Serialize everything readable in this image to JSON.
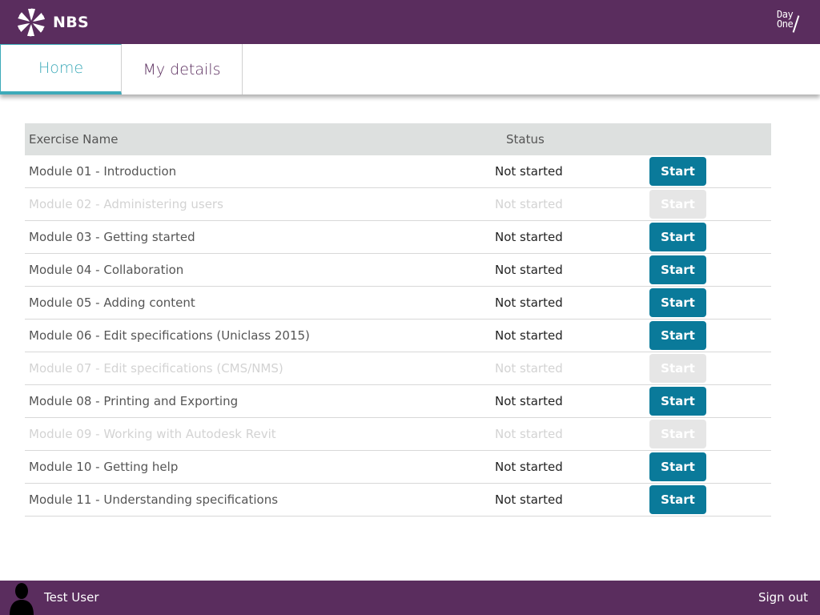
{
  "header": {
    "brand": "NBS",
    "partner_logo": [
      "Day",
      "One"
    ]
  },
  "tabs": [
    {
      "label": "Home",
      "active": true
    },
    {
      "label": "My details",
      "active": false
    }
  ],
  "table": {
    "columns": [
      "Exercise Name",
      "Status"
    ],
    "rows": [
      {
        "name": "Module 01 - Introduction",
        "status": "Not started",
        "button": "Start",
        "enabled": true
      },
      {
        "name": "Module 02 - Administering users",
        "status": "Not started",
        "button": "Start",
        "enabled": false
      },
      {
        "name": "Module 03 - Getting started",
        "status": "Not started",
        "button": "Start",
        "enabled": true
      },
      {
        "name": "Module 04 - Collaboration",
        "status": "Not started",
        "button": "Start",
        "enabled": true
      },
      {
        "name": "Module 05 - Adding content",
        "status": "Not started",
        "button": "Start",
        "enabled": true
      },
      {
        "name": "Module 06 - Edit specifications (Uniclass 2015)",
        "status": "Not started",
        "button": "Start",
        "enabled": true
      },
      {
        "name": "Module 07 - Edit specifications (CMS/NMS)",
        "status": "Not started",
        "button": "Start",
        "enabled": false
      },
      {
        "name": "Module 08 - Printing and Exporting",
        "status": "Not started",
        "button": "Start",
        "enabled": true
      },
      {
        "name": "Module 09 - Working with Autodesk Revit",
        "status": "Not started",
        "button": "Start",
        "enabled": false
      },
      {
        "name": "Module 10 - Getting help",
        "status": "Not started",
        "button": "Start",
        "enabled": true
      },
      {
        "name": "Module 11 - Understanding specifications",
        "status": "Not started",
        "button": "Start",
        "enabled": true
      }
    ]
  },
  "footer": {
    "user_name": "Test User",
    "sign_out": "Sign out"
  },
  "colors": {
    "brand_purple": "#5a2d5e",
    "active_tab_teal": "#3daab9",
    "start_button": "#0a7a9a",
    "disabled_button": "#e6e6e6",
    "header_row": "#dde0df"
  },
  "icons": {
    "brand_logo": "nbs-flower-logo-icon",
    "user_avatar": "user-silhouette-icon"
  }
}
